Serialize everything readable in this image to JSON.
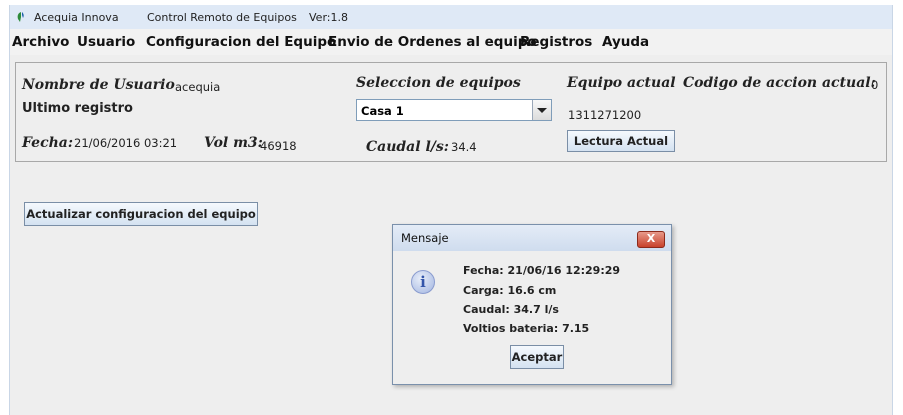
{
  "window": {
    "app_name": "Acequia Innova",
    "subtitle": "Control Remoto de Equipos",
    "version": "Ver:1.8"
  },
  "menu": [
    "Archivo",
    "Usuario",
    "Configuracion del Equipo",
    "Envio de Ordenes al equipo",
    "Registros",
    "Ayuda"
  ],
  "panel": {
    "usuario_label": "Nombre de Usuario",
    "usuario_value": "acequia",
    "ultimo_registro_label": "Ultimo registro",
    "fecha_label": "Fecha:",
    "fecha_value": "21/06/2016 03:21",
    "vol_label": "Vol m3:",
    "vol_value": "46918",
    "seleccion_label": "Seleccion de equipos",
    "seleccion_value": "Casa 1",
    "caudal_label": "Caudal l/s:",
    "caudal_value": "34.4",
    "equipo_label": "Equipo actual",
    "equipo_value": "1311271200",
    "lectura_button": "Lectura Actual",
    "codigo_label": "Codigo de accion actual:",
    "codigo_value": "0"
  },
  "actualizar_button": "Actualizar configuracion del equipo",
  "dialog": {
    "title": "Mensaje",
    "close": "X",
    "icon_glyph": "i",
    "lines": [
      "Fecha: 21/06/16 12:29:29",
      "Carga: 16.6 cm",
      "Caudal: 34.7 l/s",
      "Voltios bateria: 7.15"
    ],
    "ok_button": "Aceptar"
  },
  "colors": {
    "accent": "#2e8b3a",
    "titlebar": "#dfe9f6",
    "close_button": "#c8412b"
  }
}
